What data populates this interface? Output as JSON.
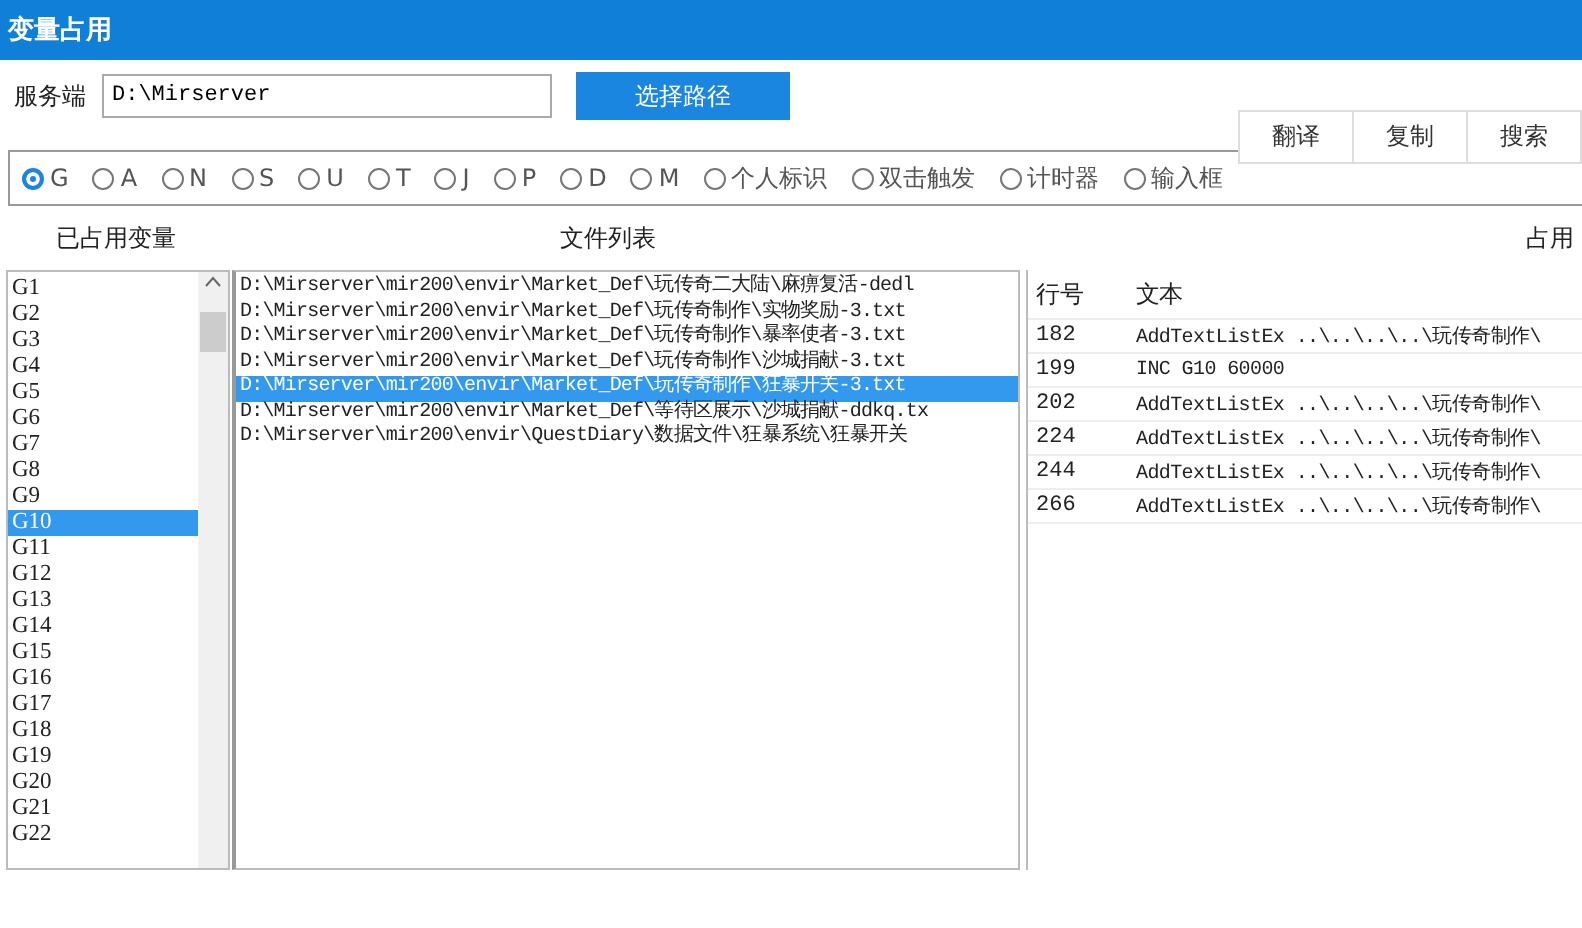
{
  "window": {
    "title": "变量占用"
  },
  "toolbar_buttons": [
    "翻译",
    "复制",
    "搜索"
  ],
  "server": {
    "label": "服务端",
    "value": "D:\\Mirserver",
    "button": "选择路径"
  },
  "variable_types": [
    {
      "label": "G",
      "selected": true
    },
    {
      "label": "A",
      "selected": false
    },
    {
      "label": "N",
      "selected": false
    },
    {
      "label": "S",
      "selected": false
    },
    {
      "label": "U",
      "selected": false
    },
    {
      "label": "T",
      "selected": false
    },
    {
      "label": "J",
      "selected": false
    },
    {
      "label": "P",
      "selected": false
    },
    {
      "label": "D",
      "selected": false
    },
    {
      "label": "M",
      "selected": false
    },
    {
      "label": "个人标识",
      "selected": false
    },
    {
      "label": "双击触发",
      "selected": false
    },
    {
      "label": "计时器",
      "selected": false
    },
    {
      "label": "输入框",
      "selected": false
    }
  ],
  "used_variables": {
    "title": "已占用变量",
    "items": [
      {
        "label": "G1",
        "selected": false
      },
      {
        "label": "G2",
        "selected": false
      },
      {
        "label": "G3",
        "selected": false
      },
      {
        "label": "G4",
        "selected": false
      },
      {
        "label": "G5",
        "selected": false
      },
      {
        "label": "G6",
        "selected": false
      },
      {
        "label": "G7",
        "selected": false
      },
      {
        "label": "G8",
        "selected": false
      },
      {
        "label": "G9",
        "selected": false
      },
      {
        "label": "G10",
        "selected": true
      },
      {
        "label": "G11",
        "selected": false
      },
      {
        "label": "G12",
        "selected": false
      },
      {
        "label": "G13",
        "selected": false
      },
      {
        "label": "G14",
        "selected": false
      },
      {
        "label": "G15",
        "selected": false
      },
      {
        "label": "G16",
        "selected": false
      },
      {
        "label": "G17",
        "selected": false
      },
      {
        "label": "G18",
        "selected": false
      },
      {
        "label": "G19",
        "selected": false
      },
      {
        "label": "G20",
        "selected": false
      },
      {
        "label": "G21",
        "selected": false
      },
      {
        "label": "G22",
        "selected": false
      }
    ]
  },
  "file_list": {
    "title": "文件列表",
    "items": [
      {
        "label": "D:\\Mirserver\\mir200\\envir\\Market_Def\\玩传奇二大陆\\麻痹复活-dedl",
        "selected": false
      },
      {
        "label": "D:\\Mirserver\\mir200\\envir\\Market_Def\\玩传奇制作\\实物奖励-3.txt",
        "selected": false
      },
      {
        "label": "D:\\Mirserver\\mir200\\envir\\Market_Def\\玩传奇制作\\暴率使者-3.txt",
        "selected": false
      },
      {
        "label": "D:\\Mirserver\\mir200\\envir\\Market_Def\\玩传奇制作\\沙城捐献-3.txt",
        "selected": false
      },
      {
        "label": "D:\\Mirserver\\mir200\\envir\\Market_Def\\玩传奇制作\\狂暴开关-3.txt",
        "selected": true
      },
      {
        "label": "D:\\Mirserver\\mir200\\envir\\Market_Def\\等待区展示\\沙城捐献-ddkq.tx",
        "selected": false
      },
      {
        "label": "D:\\Mirserver\\mir200\\envir\\QuestDiary\\数据文件\\狂暴系统\\狂暴开关",
        "selected": false
      }
    ]
  },
  "usage": {
    "title": "占用",
    "columns": [
      "行号",
      "文本"
    ],
    "rows": [
      {
        "line": "182",
        "text": "AddTextListEx ..\\..\\..\\..\\玩传奇制作\\"
      },
      {
        "line": "199",
        "text": "INC G10 60000"
      },
      {
        "line": "202",
        "text": "AddTextListEx ..\\..\\..\\..\\玩传奇制作\\"
      },
      {
        "line": "224",
        "text": "AddTextListEx ..\\..\\..\\..\\玩传奇制作\\"
      },
      {
        "line": "244",
        "text": "AddTextListEx ..\\..\\..\\..\\玩传奇制作\\"
      },
      {
        "line": "266",
        "text": "AddTextListEx ..\\..\\..\\..\\玩传奇制作\\"
      }
    ]
  }
}
